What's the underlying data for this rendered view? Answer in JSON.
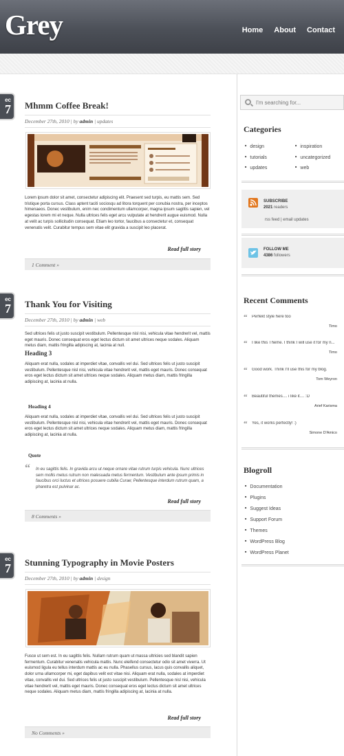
{
  "header": {
    "logo": "Grey",
    "nav": [
      "Home",
      "About",
      "Contact"
    ]
  },
  "posts": [
    {
      "date_month": "ec",
      "date_day": "7",
      "title": "Mhmm Coffee Break!",
      "meta_date": "December 27th, 2010 | by ",
      "meta_author": "admin",
      "meta_cat": " | updates",
      "body": "Lorem ipsum dolor sit amet, consectetur adipiscing elit. Praesent sed turpis, eu mattis sem. Sed tristique porta cursus. Class aptent taciti sociosqu ad litora torquent per conubia nostra, per inceptos himenaeos. Donec vestibulum, enim nec condimentum ullamcorper, magna ipsum sagittis sapien, vel egestas lorem mi et neque. Nulla ultrices felis eget arcu vulputate at hendrerit augue euismod. Nulla at velit ac turpis sollicitudin consequat. Etiam leo tortor, faucibus a consectetur et, consequat venenatis velit. Curabitur tempus sem vitae elit gravida a suscipit leo placerat.",
      "read_more": "Read full story",
      "comments": "1 Comment »"
    },
    {
      "date_month": "ec",
      "date_day": "7",
      "title": "Thank You for Visiting",
      "meta_date": "December 27th, 2010 | by ",
      "meta_author": "admin",
      "meta_cat": " | web",
      "body": "Sed ultrices felis ut justo suscipit vestibulum. Pellentesque nisl nisi, vehicula vitae hendrerit vel, mattis eget mauris. Donec consequat eros eget lectus dictum sit amet ultrices neque sodales. Aliquam metus diam, mattis fringilla adipiscing at, lacinia at null.",
      "heading3": "Heading 3",
      "body2": "Aliquam erat nulla, sodales at imperdiet vitae, convallis vel dui. Sed ultrices felis ut justo suscipit vestibulum. Pellentesque nisl nisi, vehicula vitae hendrerit vel, mattis eget mauris. Donec consequat eros eget lectus dictum sit amet ultrices neque sodales. Aliquam metus diam, mattis fringilla adipiscing at, lacinia at nulla.",
      "heading4": "Heading 4",
      "body3": "Aliquam erat nulla, sodales at imperdiet vitae, convallis vel dui. Sed ultrices felis ut justo suscipit vestibulum. Pellentesque nisl nisi, vehicula vitae hendrerit vel, mattis eget mauris. Donec consequat eros eget lectus dictum sit amet ultrices neque sodales. Aliquam metus diam, mattis fringilla adipiscing at, lacinia at nulla.",
      "quote_label": "Quote",
      "quote": "In eu sagittis felis. In gravida arcu ut neque ornare vitae rutrum turpis vehicula. Nunc ultrices sem mollis metus rutrum non malesuada metus fermentum. Vestibulum ante ipsum primis in faucibus orci luctus et ultrices posuere cubilia Curae; Pellentesque interdum rutrum quam, a pharetra est pulvinar ac.",
      "read_more": "Read full story",
      "comments": "8 Comments »"
    },
    {
      "date_month": "ec",
      "date_day": "7",
      "title": "Stunning Typography in Movie Posters",
      "meta_date": "December 27th, 2010 | by ",
      "meta_author": "admin",
      "meta_cat": " | design",
      "body": "Fusce ut sem est. In eu sagittis felis. Nullam rutrum quam ut massa ultricies sed blandit sapien fermentum. Curabitur venenatis vehicula mattis. Nunc eleifend consectetur odio sit amet viverra. Ut euismod ligula eu tellus interdum mattis ac eu nulla. Phasellus cursus, lacus quis convallis aliquet, dolor urna ullamcorper mi, eget dapibus velit est vitae nisi. Aliquam erat nulla, sodales at imperdiet vitae, convallis vel dui. Sed ultrices felis ut justo suscipit vestibulum. Pellentesque nisl nisi, vehicula vitae hendrerit vel, mattis eget mauris. Donec consequat eros eget lectus dictum sit amet ultrices neque sodales. Aliquam metus diam, mattis fringilla adipiscing at, lacinia at nulla.",
      "read_more": "Read full story",
      "comments": "No Comments »"
    }
  ],
  "sidebar": {
    "search_placeholder": "I'm searching for...",
    "categories_title": "Categories",
    "categories": [
      "design",
      "inspiration",
      "tutorials",
      "uncategorized",
      "updates",
      "web"
    ],
    "subscribe": {
      "title": "SUBSCRIBE",
      "count": "2021",
      "count_suffix": " readers",
      "links": "rss feed | email updates"
    },
    "follow": {
      "title": "FOLLOW ME",
      "count": "4386",
      "count_suffix": " followers"
    },
    "recent_title": "Recent Comments",
    "recent": [
      {
        "text": "Perfekt style here too",
        "author": "Timo"
      },
      {
        "text": "I like this Theme. I think I will use it for my n...",
        "author": "Timo"
      },
      {
        "text": "Good work. Think I'll use this for my blog.",
        "author": "Tom Weyron"
      },
      {
        "text": "Beautiful themes.... i like it.... :D",
        "author": "Arief Karisma"
      },
      {
        "text": "Yes, it works perfectly! :)",
        "author": "Simone D'Amico"
      }
    ],
    "blogroll_title": "Blogroll",
    "blogroll": [
      "Documentation",
      "Plugins",
      "Suggest Ideas",
      "Support Forum",
      "Themes",
      "WordPress Blog",
      "WordPress Planet"
    ]
  }
}
